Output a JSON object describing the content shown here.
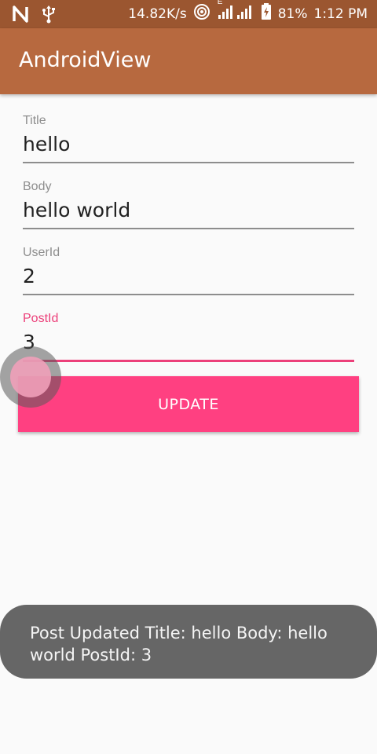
{
  "status_bar": {
    "net_speed": "14.82K/s",
    "signal_label": "E",
    "battery": "81%",
    "time": "1:12 PM",
    "icons": [
      "n-notification-icon",
      "usb-icon",
      "hotspot-icon",
      "signal-icon",
      "battery-icon"
    ]
  },
  "app_bar": {
    "title": "AndroidView"
  },
  "form": {
    "title": {
      "label": "Title",
      "value": "hello"
    },
    "body": {
      "label": "Body",
      "value": "hello world"
    },
    "user_id": {
      "label": "UserId",
      "value": "2"
    },
    "post_id": {
      "label": "PostId",
      "value": "3"
    }
  },
  "update_button": {
    "label": "UPDATE"
  },
  "toast": {
    "message": "Post Updated Title: hello Body: hello world PostId: 3"
  },
  "colors": {
    "accent": "#ff4081",
    "app_bar": "#b7693f",
    "status_bar": "#9b5630"
  }
}
